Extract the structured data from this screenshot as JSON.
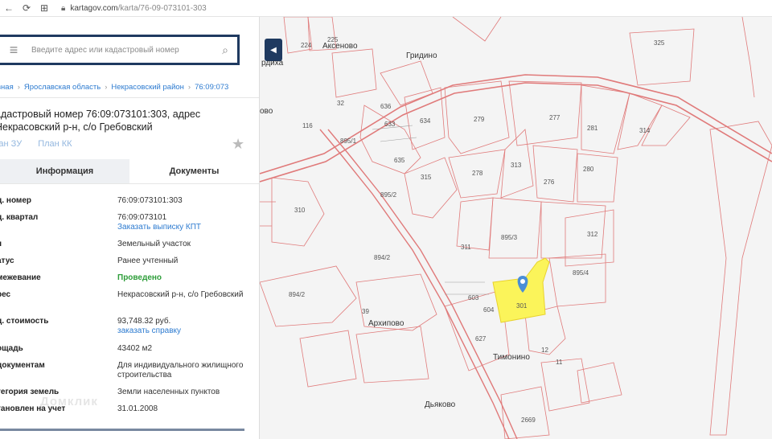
{
  "browser": {
    "url_host": "kartagov.com",
    "url_path": "/karta/76-09-073101-303"
  },
  "search": {
    "placeholder": "Введите адрес или кадастровый номер"
  },
  "breadcrumbs": [
    "вная",
    "Ярославская область",
    "Некрасовский район",
    "76:09:073"
  ],
  "object_title": "адастровый номер 76:09:073101:303, адрес Некрасовский р-н, с/о Гребовский",
  "plan_links": [
    "лан ЗУ",
    "План КК"
  ],
  "tabs": [
    "Информация",
    "Документы"
  ],
  "details": [
    {
      "label": "д. номер",
      "value": "76:09:073101:303"
    },
    {
      "label": "д. квартал",
      "value": "76:09:073101",
      "link": "Заказать выписку КПТ"
    },
    {
      "label": "п",
      "value": "Земельный участок"
    },
    {
      "label": "атус",
      "value": "Ранее учтенный"
    },
    {
      "label": "межевание",
      "value": "Проведено",
      "highlight": true
    },
    {
      "label": "рес",
      "value": "Некрасовский р-н, с/о Гребовский"
    },
    {
      "label": "д. стоимость",
      "value": "93,748.32 руб.",
      "link": "заказать справку"
    },
    {
      "label": "ощадь",
      "value": "43402 м2"
    },
    {
      "label": "документам",
      "value": "Для индивидуального жилищного строительства"
    },
    {
      "label": "тегория земель",
      "value": "Земли населенных пунктов"
    },
    {
      "label": "тановлен на учет",
      "value": "31.01.2008"
    }
  ],
  "watermark": "Домклик",
  "map": {
    "villages": [
      "Аксеново",
      "Гридино",
      "рдиха",
      "ово",
      "Архипово",
      "Тимонино",
      "Дьяково"
    ],
    "parcels": [
      "225",
      "224",
      "325",
      "636",
      "633",
      "634",
      "279",
      "277",
      "281",
      "314",
      "635",
      "278",
      "313",
      "280",
      "315",
      "276",
      "310",
      "895/2",
      "311",
      "895/3",
      "312",
      "894/2",
      "895/4",
      "301",
      "894/2",
      "39",
      "12",
      "2669",
      "895/1",
      "627",
      "603",
      "604",
      "11",
      "116",
      "32"
    ],
    "selected_parcel_color": "#fbf45a",
    "line_color": "#e07a7a"
  }
}
